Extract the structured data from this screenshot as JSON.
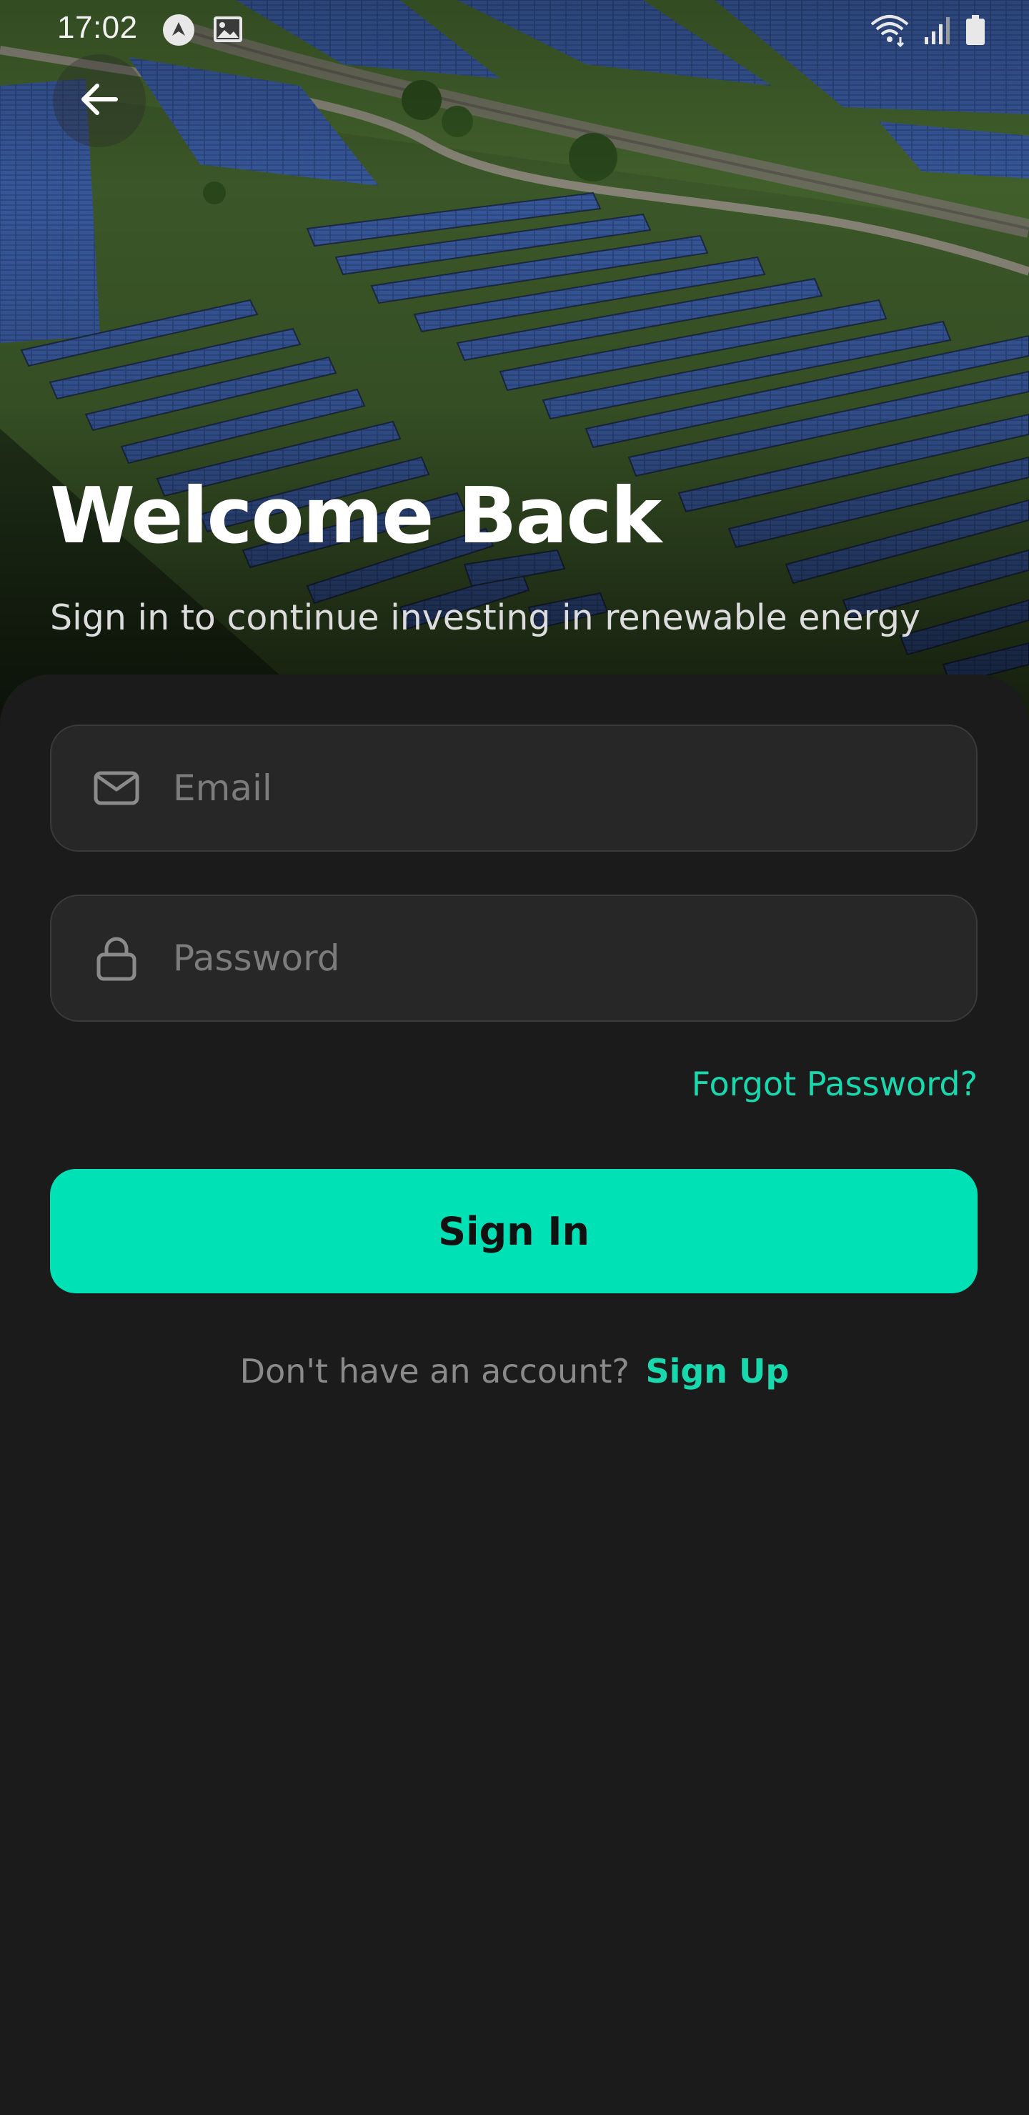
{
  "status_bar": {
    "time": "17:02",
    "left_icons": [
      "navigation-arrow-icon",
      "image-icon"
    ],
    "right_icons": [
      "wifi-icon",
      "signal-icon",
      "battery-icon"
    ]
  },
  "header": {
    "back_icon": "arrow-left-icon",
    "hero_image": "solar-farm-photo"
  },
  "hero": {
    "title": "Welcome Back",
    "subtitle": "Sign in to continue investing in renewable energy"
  },
  "form": {
    "email": {
      "icon": "mail-icon",
      "placeholder": "Email",
      "value": ""
    },
    "password": {
      "icon": "lock-icon",
      "placeholder": "Password",
      "value": ""
    },
    "forgot_label": "Forgot Password?",
    "submit_label": "Sign In"
  },
  "footer": {
    "prompt": "Don't have an account?",
    "signup_label": "Sign Up"
  },
  "colors": {
    "accent": "#00e2b6",
    "link": "#18d9ad",
    "background": "#1b1b1b",
    "field_bg": "#272727"
  }
}
